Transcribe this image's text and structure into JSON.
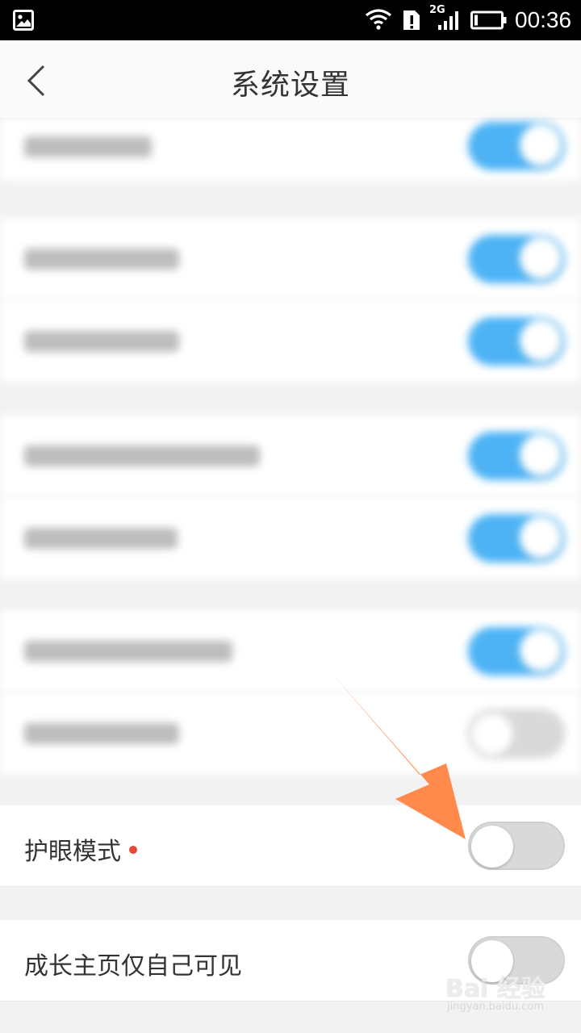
{
  "status_bar": {
    "network_type": "2G",
    "time": "00:36"
  },
  "header": {
    "title": "系统设置"
  },
  "settings": {
    "eye_mode": {
      "label": "护眼模式",
      "state": "off",
      "has_new_dot": true
    },
    "growth_private": {
      "label": "成长主页仅自己可见",
      "state": "off"
    }
  },
  "blurred_toggles": [
    "on",
    "on",
    "on",
    "on",
    "on",
    "on",
    "off"
  ],
  "watermark": {
    "logo": "Bai 经验",
    "url": "jingyan.baidu.com"
  },
  "colors": {
    "toggle_on": "#4db3f5",
    "toggle_off": "#d9d9d9",
    "new_dot": "#e8483b",
    "arrow": "#ff8a4c"
  }
}
